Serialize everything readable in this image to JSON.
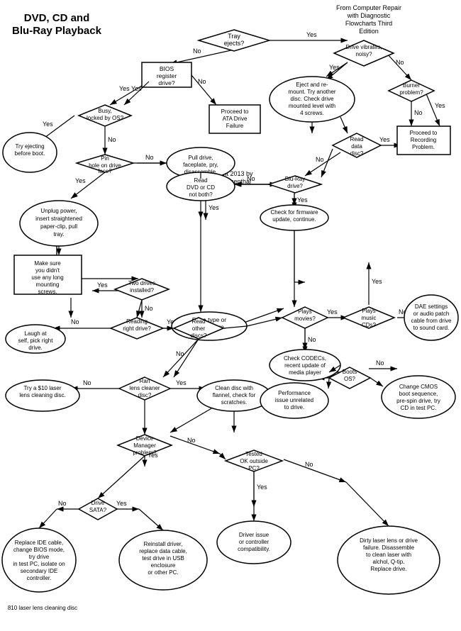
{
  "title": "DVD, CD and Blu-Ray Playback",
  "source": "From Computer Repair with Diagnostic Flowcharts Third Edition",
  "copyright": "Copyright 2013 by Morris Rosenthal",
  "nodes": {
    "title": "DVD, CD and\nBlu-Ray Playback",
    "tray_ejects": "Tray ejects?",
    "bios_register": "BIOS register drive?",
    "busy_locked": "Busy, locked by OS?",
    "try_ejecting": "Try ejecting before boot.",
    "proceed_ata": "Proceed to ATA Drive Failure",
    "pin_hole": "Pin hole on drive face?",
    "unplug_power": "Unplug power, insert straightened paper-clip, pull tray.",
    "pull_drive": "Pull drive, faceplate, pry, disassemble.",
    "make_sure": "Make sure you didn't use any long mounting screws.",
    "drive_vibrates": "Drive vibrates, noisy?",
    "eject_remount": "Eject and re-mount. Try another disc. Check drive mounted level with 4 screws.",
    "burner_problem": "Burner problem?",
    "read_data_disc": "Read data disc?",
    "proceed_recording": "Proceed to Recording Problem.",
    "read_dvd_cd": "Read DVD or CD not both?",
    "blu_ray_drive": "Blu-Ray drive?",
    "check_firmware": "Check for firmware update, continue.",
    "drive_type_laser": "Drive type or laser failure.",
    "two_drives": "Two drives installed?",
    "reading_right": "Reading right drive?",
    "laugh_self": "Laugh at self, pick right drive.",
    "read_other_discs": "Read other discs?",
    "plays_movies": "Plays movies?",
    "plays_music_cds": "Plays music CDs?",
    "dae_settings": "DAE settings or audio patch cable from drive to sound card.",
    "check_codecs": "Check CODECs, recent update of media player",
    "ran_lens_cleaner": "Ran lens cleaner disc?",
    "try_10_dollar": "Try a $10 laser lens cleaning disc.",
    "clean_disc": "Clean disc with flannel, check for scratches.",
    "boots_os": "Boots OS?",
    "performance_issue": "Performance issue unrelated to drive.",
    "change_cmos": "Change CMOS boot sequence, pre-spin drive, try CD in test PC.",
    "device_manager": "Device Manager problem?",
    "tested_ok": "Tested OK outside PC?",
    "drive_sata": "Drive SATA?",
    "replace_ide": "Replace IDE cable, change BIOS mode, try drive in test PC, isolate on secondary IDE controller.",
    "reinstall_driver": "Reinstall driver, replace data cable, test drive in USB enclosure or other PC.",
    "driver_issue": "Driver issue or controller compatibility.",
    "dirty_laser": "Dirty laser lens or drive failure. Disassemble to clean laser with alchol, Q-tip. Replace drive.",
    "810_lens": "810 laser lens cleaning disc"
  },
  "labels": {
    "yes": "Yes",
    "no": "No"
  }
}
